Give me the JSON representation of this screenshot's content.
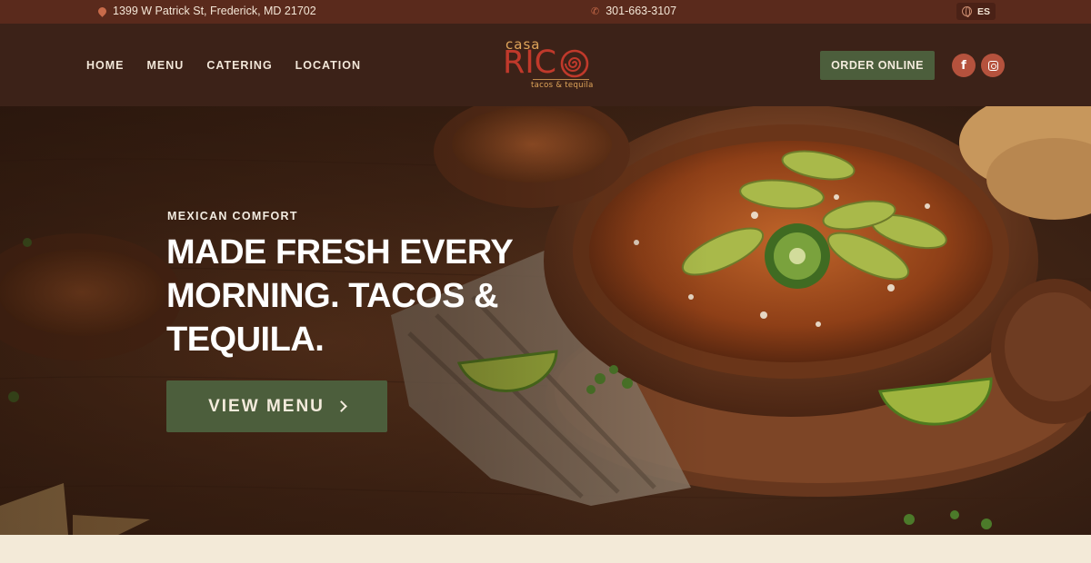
{
  "topbar": {
    "address": "1399 W Patrick St, Frederick, MD 21702",
    "phone": "301-663-3107",
    "language": "ES",
    "address_icon": "map-pin-icon",
    "phone_icon": "phone-icon",
    "language_icon": "globe-icon"
  },
  "nav": {
    "items": [
      {
        "label": "HOME"
      },
      {
        "label": "MENU"
      },
      {
        "label": "CATERING"
      },
      {
        "label": "LOCATION"
      }
    ]
  },
  "logo": {
    "casa": "casa",
    "rico": "RIC",
    "tagline": "tacos & tequila"
  },
  "header": {
    "order_label": "ORDER ONLINE",
    "social": [
      {
        "icon": "facebook-icon",
        "glyph": "f"
      },
      {
        "icon": "instagram-icon"
      }
    ]
  },
  "hero": {
    "eyebrow": "MEXICAN COMFORT",
    "headline": "MADE FRESH EVERY MORNING. TACOS & TEQUILA.",
    "cta_label": "VIEW MENU",
    "cta_icon": "chevron-right-icon"
  },
  "colors": {
    "topbar_bg": "#5a2a1c",
    "header_bg": "#3c2218",
    "button_green": "#4c5e3c",
    "social_red": "#b5523d",
    "logo_red": "#c0392b",
    "logo_gold": "#e0a55a",
    "cream": "#f3ead8"
  }
}
